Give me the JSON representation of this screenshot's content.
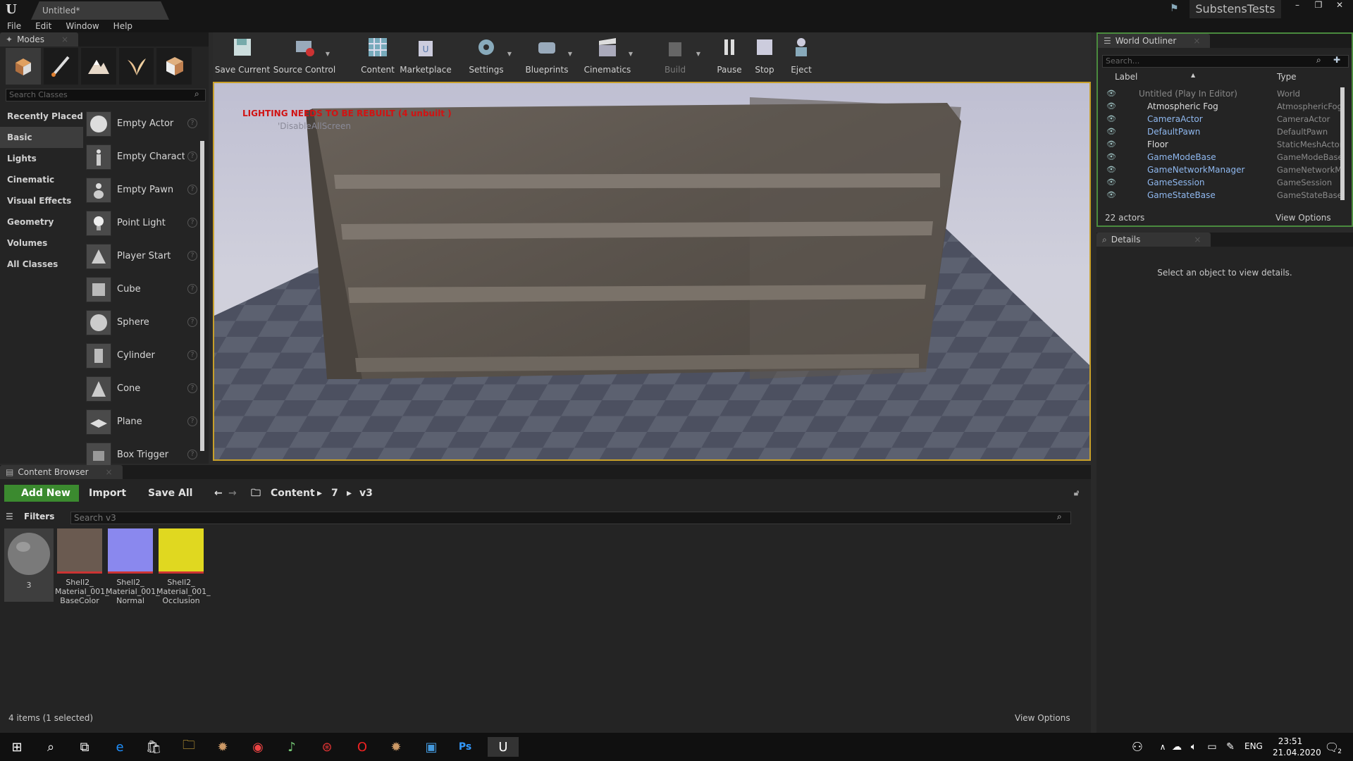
{
  "window": {
    "doc_tab": "Untitled*",
    "project": "SubstensTests"
  },
  "menu": [
    "File",
    "Edit",
    "Window",
    "Help"
  ],
  "modes": {
    "tab": "Modes",
    "search_placeholder": "Search Classes",
    "categories": [
      "Recently Placed",
      "Basic",
      "Lights",
      "Cinematic",
      "Visual Effects",
      "Geometry",
      "Volumes",
      "All Classes"
    ],
    "items": [
      "Empty Actor",
      "Empty Charact",
      "Empty Pawn",
      "Point Light",
      "Player Start",
      "Cube",
      "Sphere",
      "Cylinder",
      "Cone",
      "Plane",
      "Box Trigger"
    ]
  },
  "toolbar": {
    "save_current": "Save Current",
    "source_control": "Source Control",
    "content": "Content",
    "marketplace": "Marketplace",
    "settings": "Settings",
    "blueprints": "Blueprints",
    "cinematics": "Cinematics",
    "build": "Build",
    "pause": "Pause",
    "stop": "Stop",
    "eject": "Eject"
  },
  "viewport": {
    "warning": "LIGHTING NEEDS TO BE REBUILT (4 unbuilt )",
    "subtext": "'DisableAllScreen"
  },
  "outliner": {
    "tab": "World Outliner",
    "search_placeholder": "Search...",
    "col_label": "Label",
    "col_type": "Type",
    "rows": [
      {
        "label": "Untitled (Play In Editor)",
        "type": "World"
      },
      {
        "label": "Atmospheric Fog",
        "type": "AtmosphericFog"
      },
      {
        "label": "CameraActor",
        "type": "CameraActor"
      },
      {
        "label": "DefaultPawn",
        "type": "DefaultPawn"
      },
      {
        "label": "Floor",
        "type": "StaticMeshActor"
      },
      {
        "label": "GameModeBase",
        "type": "GameModeBase"
      },
      {
        "label": "GameNetworkManager",
        "type": "GameNetworkMa"
      },
      {
        "label": "GameSession",
        "type": "GameSession"
      },
      {
        "label": "GameStateBase",
        "type": "GameStateBase"
      }
    ],
    "actor_count": "22 actors",
    "view_options": "View Options"
  },
  "details": {
    "tab": "Details",
    "message": "Select an object to view details."
  },
  "content_browser": {
    "tab": "Content Browser",
    "add_new": "Add New",
    "import": "Import",
    "save_all": "Save All",
    "path": [
      "Content",
      "7",
      "v3"
    ],
    "filters": "Filters",
    "search_placeholder": "Search v3",
    "assets": [
      {
        "name": "3"
      },
      {
        "name": "Shell2_ Material_001_ BaseColor"
      },
      {
        "name": "Shell2_ Material_001_ Normal"
      },
      {
        "name": "Shell2_ Material_001_ Occlusion"
      }
    ],
    "status": "4 items (1 selected)",
    "view_options": "View Options"
  },
  "taskbar": {
    "lang": "ENG",
    "time": "23:51",
    "date": "21.04.2020",
    "notif_count": "2"
  }
}
